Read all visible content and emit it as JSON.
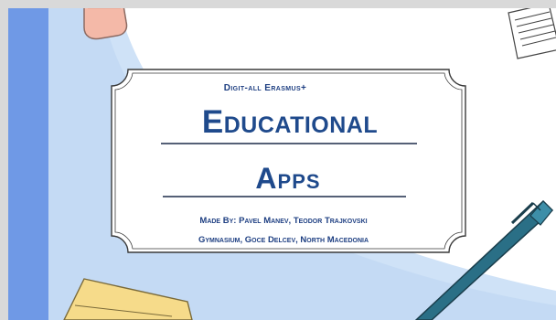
{
  "slide": {
    "kicker": "Digit-all Erasmus+",
    "title_line1": "Educational",
    "title_line2": "Apps",
    "credit_line1": "Made By: Pavel Manev, Teodor Trajkovski",
    "credit_line2": "Gymnasium, Goce Delcev, North Macedonia"
  },
  "colors": {
    "accent": "#1f4a8c",
    "stripe": "#6f99e6",
    "sky": "#cfe2f7"
  }
}
